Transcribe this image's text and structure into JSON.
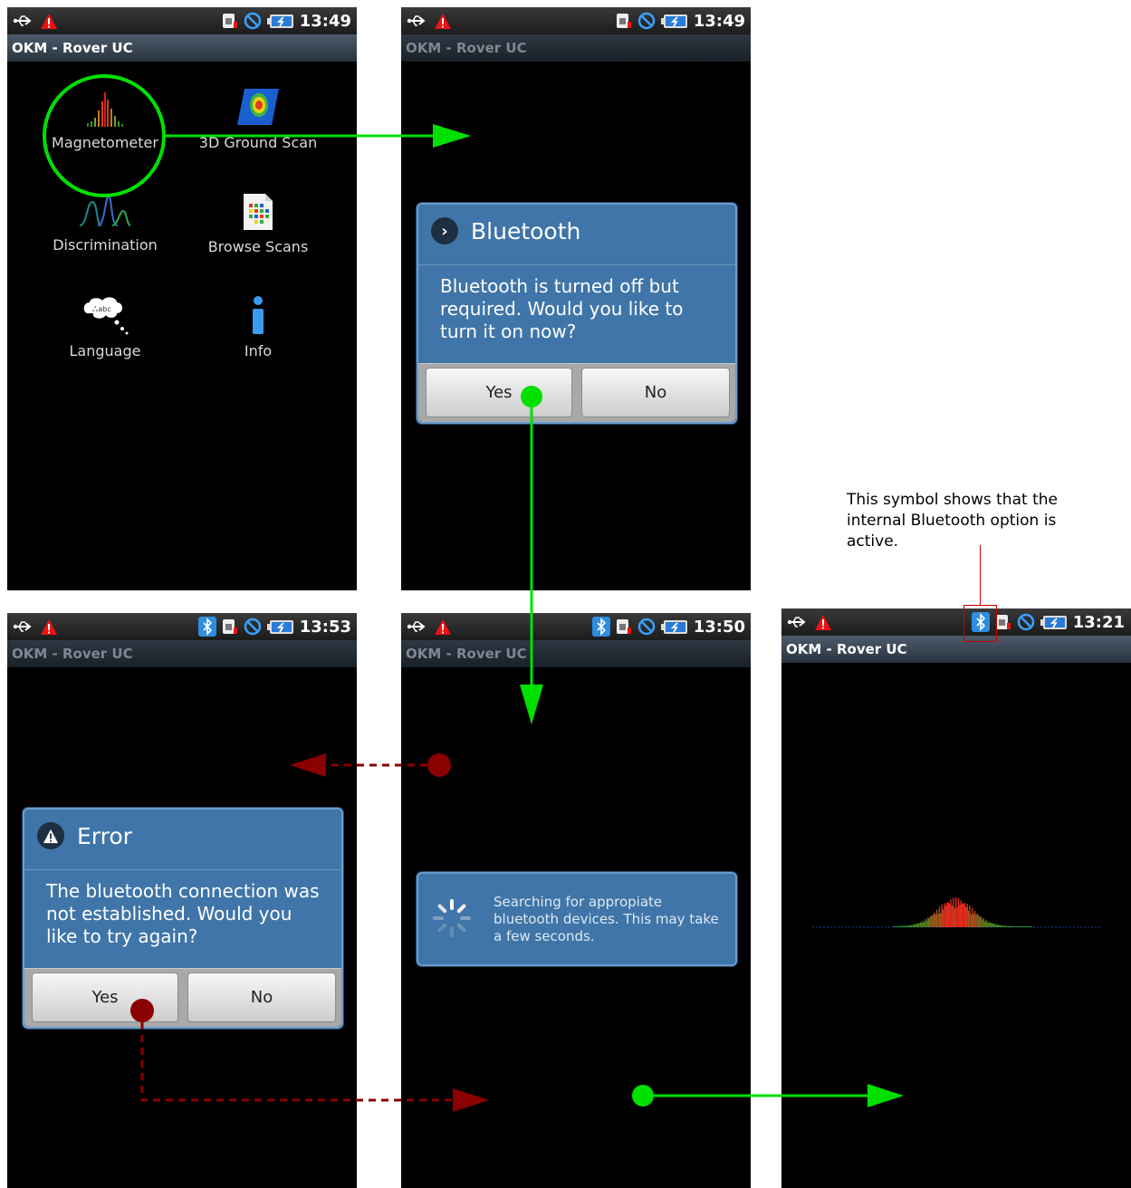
{
  "app_title": "OKM - Rover UC",
  "screens": {
    "menu": {
      "time": "13:49",
      "items": [
        {
          "label": "Magnetometer"
        },
        {
          "label": "3D Ground Scan"
        },
        {
          "label": "Discrimination"
        },
        {
          "label": "Browse Scans"
        },
        {
          "label": "Language"
        },
        {
          "label": "Info"
        }
      ]
    },
    "bluetooth_dialog": {
      "time": "13:49",
      "title": "Bluetooth",
      "message": "Bluetooth is turned off but required. Would you like to turn it on now?",
      "yes": "Yes",
      "no": "No"
    },
    "searching": {
      "time": "13:50",
      "message": "Searching for appropiate bluetooth devices. This may take a few seconds."
    },
    "error_dialog": {
      "time": "13:53",
      "title": "Error",
      "message": "The bluetooth connection was not established. Would you like to try again?",
      "yes": "Yes",
      "no": "No"
    },
    "magnetometer_view": {
      "time": "13:21"
    }
  },
  "annotation": "This symbol shows that the internal Bluetooth option is active.",
  "colors": {
    "flow_success": "#00e000",
    "flow_error": "#8b0000",
    "dialog_blue": "#3f75a8",
    "highlight_box": "#cc0000"
  },
  "icons": [
    "usb-icon",
    "warning-icon",
    "sim-icon",
    "no-signal-icon",
    "battery-icon",
    "bluetooth-icon"
  ]
}
